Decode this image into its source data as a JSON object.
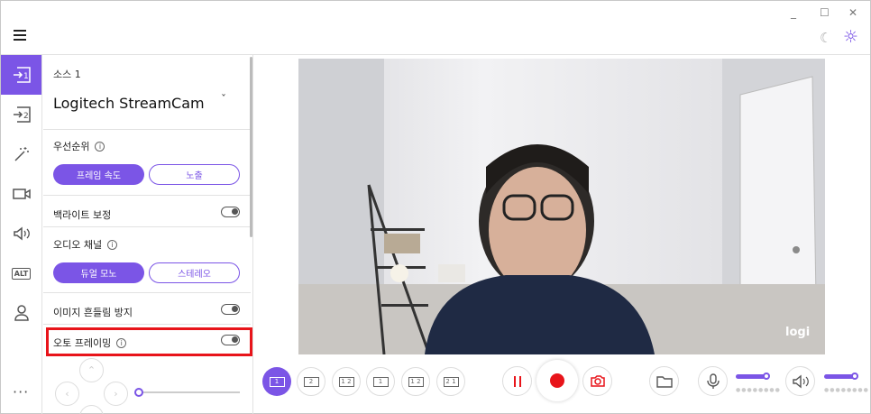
{
  "window": {
    "minimize": "_",
    "maximize": "☐",
    "close": "✕"
  },
  "rail": {
    "items": [
      "source-1-icon",
      "source-2-icon",
      "effects-icon",
      "camera-icon",
      "audio-icon",
      "alt-icon",
      "account-icon",
      "more-icon"
    ],
    "alt_text": "ALT",
    "more_text": "···"
  },
  "panel": {
    "source_label": "소스 1",
    "source_name": "Logitech StreamCam",
    "priority_label": "우선순위",
    "priority_options": [
      "프레임 속도",
      "노출"
    ],
    "backlight_label": "백라이트 보정",
    "audio_channel_label": "오디오 채널",
    "audio_options": [
      "듀얼 모노",
      "스테레오"
    ],
    "stabilization_label": "이미지 흔들림 방지",
    "auto_framing_label": "오토 프레이밍"
  },
  "preview": {
    "watermark": "logi"
  },
  "layouts": [
    "1",
    "2",
    "1 2",
    "1",
    "1 2",
    "2 1"
  ],
  "accent_color": "#7b55e6",
  "record_color": "#e8141a"
}
